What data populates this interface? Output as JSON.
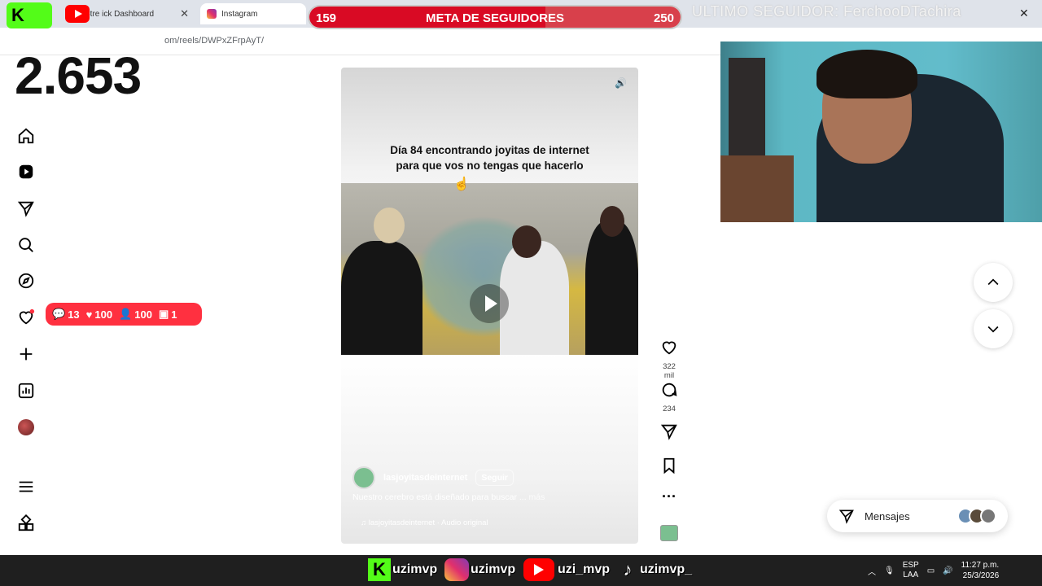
{
  "browser": {
    "tab1_title": "Stream Kick Dashboard",
    "tab1_display": "Stre    ick Dashboard",
    "tab2_title": "Instagram",
    "url": "om/reels/DWPxZFrpAyT/"
  },
  "goal": {
    "current": "159",
    "title": "META DE SEGUIDORES",
    "target": "250",
    "progress_fraction": 0.636
  },
  "last_follower": "ULTIMO SEGUIDOR: FerchooDTachira",
  "counter": "2.653",
  "notifications": {
    "comments": "13",
    "likes": "100",
    "follows": "100",
    "requests": "1"
  },
  "sidebar": {
    "items": [
      "home-icon",
      "reels-icon",
      "messages-icon",
      "search-icon",
      "explore-icon",
      "notifications-icon",
      "create-icon",
      "dashboard-icon",
      "profile-avatar",
      "menu-icon",
      "apps-icon"
    ]
  },
  "reel": {
    "caption_line1": "Día 84 encontrando joyitas de internet",
    "caption_line2": "para que vos no tengas que hacerlo",
    "account": "lasjoyitasdeinternet",
    "follow_label": "Seguir",
    "description": "Nuestro cerebro está diseñado para buscar ...",
    "more_label": "más",
    "audio": "lasjoyitasdeinternet · Audio original",
    "likes": "322 mil",
    "comments": "234"
  },
  "messages_label": "Mensajes",
  "taskbar": {
    "labels": [
      "uzimvp",
      "uzimvp",
      "uzi_mvp",
      "uzimvp_"
    ],
    "lang1": "ESP",
    "lang2": "LAA",
    "time": "11:27 p.m.",
    "date": "25/3/2026"
  },
  "colors": {
    "goal_red": "#d90a24",
    "kick_green": "#53fc18",
    "notif_red": "#ff3040"
  }
}
